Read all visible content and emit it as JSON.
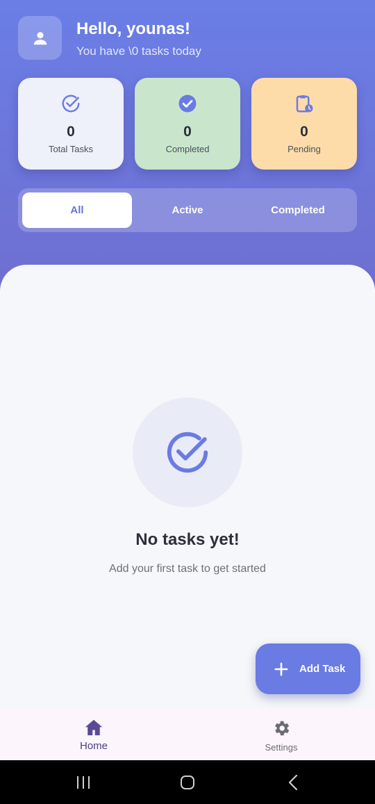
{
  "header": {
    "greeting": "Hello, younas!",
    "subtitle": "You have \\0 tasks today"
  },
  "stats": {
    "total": {
      "value": "0",
      "label": "Total Tasks"
    },
    "completed": {
      "value": "0",
      "label": "Completed"
    },
    "pending": {
      "value": "0",
      "label": "Pending"
    }
  },
  "filters": {
    "all": "All",
    "active": "Active",
    "completed": "Completed",
    "selected": "All"
  },
  "empty_state": {
    "title": "No tasks yet!",
    "subtitle": "Add your first task to get started"
  },
  "fab": {
    "label": "Add Task"
  },
  "bottom_nav": {
    "home": "Home",
    "settings": "Settings"
  },
  "colors": {
    "accent": "#6a7be3",
    "header_top": "#6a7ee6",
    "header_bottom": "#6f6fcf",
    "completed_card": "#c9e6cc",
    "pending_card": "#fddcaa",
    "total_card": "#eef0fa",
    "nav_active": "#4a3f86"
  },
  "icons": {
    "avatar": "person-icon",
    "total": "check-circle-outline-icon",
    "completed": "check-circle-filled-icon",
    "pending": "clipboard-clock-icon",
    "empty": "check-circle-outline-icon",
    "fab": "plus-icon",
    "home": "home-icon",
    "settings": "gear-icon"
  }
}
